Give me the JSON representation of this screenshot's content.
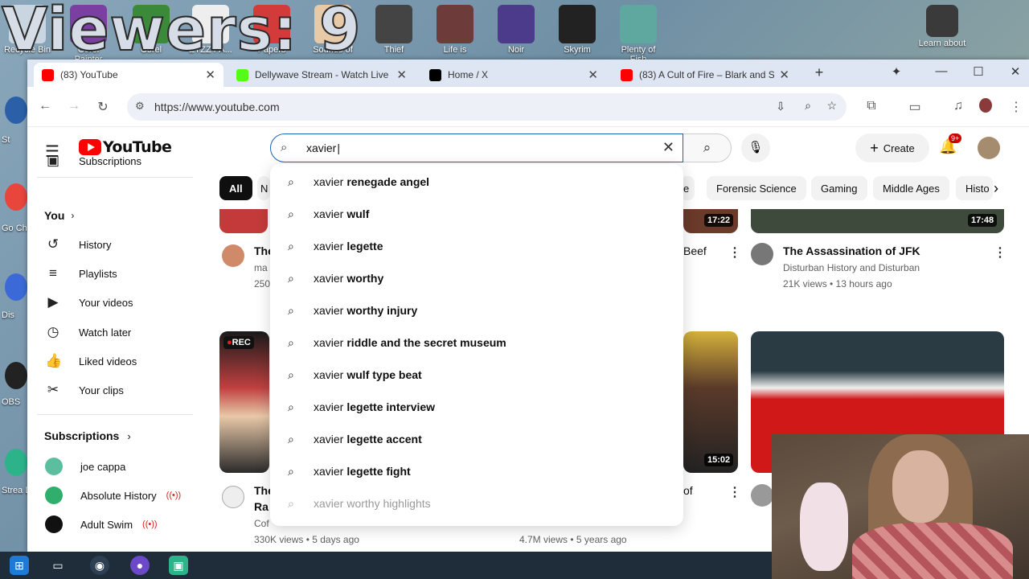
{
  "overlay": {
    "viewers_text": "Viewers: 9"
  },
  "desktop": {
    "icons": [
      {
        "label": "Recycle Bin",
        "color": "#c9d6e2"
      },
      {
        "label": "Corel Painter",
        "color": "#7a3fa0"
      },
      {
        "label": "Corel",
        "color": "#3a8a3a"
      },
      {
        "label": "ZYZZ PA...",
        "color": "#eeeeee"
      },
      {
        "label": "Papers",
        "color": "#d33a3a"
      },
      {
        "label": "Sounds of",
        "color": "#e8c9a8"
      },
      {
        "label": "Thief",
        "color": "#444444"
      },
      {
        "label": "Life is",
        "color": "#6e3b3b"
      },
      {
        "label": "Noir",
        "color": "#4b3b8a"
      },
      {
        "label": "Skyrim",
        "color": "#222222"
      },
      {
        "label": "Plenty of Fish",
        "color": "#5ea8a0"
      },
      {
        "label": "Learn about",
        "color": "#3a3a3a"
      }
    ],
    "left_labels": [
      "St",
      "Go Ch",
      "Dis",
      "OBS",
      "Strea De"
    ]
  },
  "browser": {
    "tabs": [
      {
        "title": "(83) YouTube",
        "favicon_color": "#ff0000",
        "active": true
      },
      {
        "title": "Dellywave Stream - Watch Live",
        "favicon_color": "#53fc18",
        "active": false
      },
      {
        "title": "Home / X",
        "favicon_color": "#000000",
        "active": false
      },
      {
        "title": "(83) A Cult of Fire – Blark and S",
        "favicon_color": "#ff0000",
        "active": false
      }
    ],
    "new_tab": "+",
    "url": "https://www.youtube.com"
  },
  "youtube": {
    "logo_text": "YouTube",
    "search": {
      "value": "xavier",
      "suggestions": [
        {
          "prefix": "xavier",
          "rest": "renegade angel"
        },
        {
          "prefix": "xavier",
          "rest": "wulf"
        },
        {
          "prefix": "xavier",
          "rest": "legette"
        },
        {
          "prefix": "xavier",
          "rest": "worthy"
        },
        {
          "prefix": "xavier",
          "rest": "worthy injury"
        },
        {
          "prefix": "xavier",
          "rest": "riddle and the secret museum"
        },
        {
          "prefix": "xavier",
          "rest": "wulf type beat"
        },
        {
          "prefix": "xavier",
          "rest": "legette interview"
        },
        {
          "prefix": "xavier",
          "rest": "legette accent"
        },
        {
          "prefix": "xavier",
          "rest": "legette fight"
        },
        {
          "prefix": "xavier",
          "rest": "worthy highlights"
        }
      ]
    },
    "create_label": "Create",
    "notif_badge": "9+",
    "sidebar": {
      "partial_top": "Subscriptions",
      "you_label": "You",
      "items": [
        {
          "label": "History",
          "icon": "history-icon",
          "glyph": "↺"
        },
        {
          "label": "Playlists",
          "icon": "playlists-icon",
          "glyph": "≡"
        },
        {
          "label": "Your videos",
          "icon": "your-videos-icon",
          "glyph": "▶"
        },
        {
          "label": "Watch later",
          "icon": "watch-later-icon",
          "glyph": "◷"
        },
        {
          "label": "Liked videos",
          "icon": "liked-videos-icon",
          "glyph": "👍"
        },
        {
          "label": "Your clips",
          "icon": "clips-icon",
          "glyph": "✂"
        }
      ],
      "subscriptions_label": "Subscriptions",
      "subscriptions": [
        {
          "label": "joe cappa",
          "color": "#5bbf9f",
          "live": false
        },
        {
          "label": "Absolute History",
          "color": "#2fae6e",
          "live": true
        },
        {
          "label": "Adult Swim",
          "color": "#111111",
          "live": true
        }
      ]
    },
    "chips": [
      "All",
      "Forensic Science",
      "Gaming",
      "Middle Ages",
      "Histo"
    ],
    "chip_fragment_left": "N",
    "chip_fragment_right": "e",
    "videos": {
      "v1_fragment_title": "The",
      "v1_fragment_channel": "ma",
      "v1_fragment_views": "250",
      "v2_fragment_title": "Beef",
      "v2_duration": "17:22",
      "v3": {
        "title": "The Assassination of JFK",
        "channel": "Disturban History and Disturban",
        "meta": "21K views • 13 hours ago",
        "duration": "17:48"
      },
      "v4_fragment_title": "The",
      "v4_fragment_line2": "Ra",
      "v4_fragment_channel": "Cof",
      "v4_meta": "330K views • 5 days ago",
      "v4_rec": "REC",
      "v5_duration": "15:02",
      "v5_fragment_title": "of",
      "v5_meta": "4.7M views • 5 years ago"
    }
  }
}
